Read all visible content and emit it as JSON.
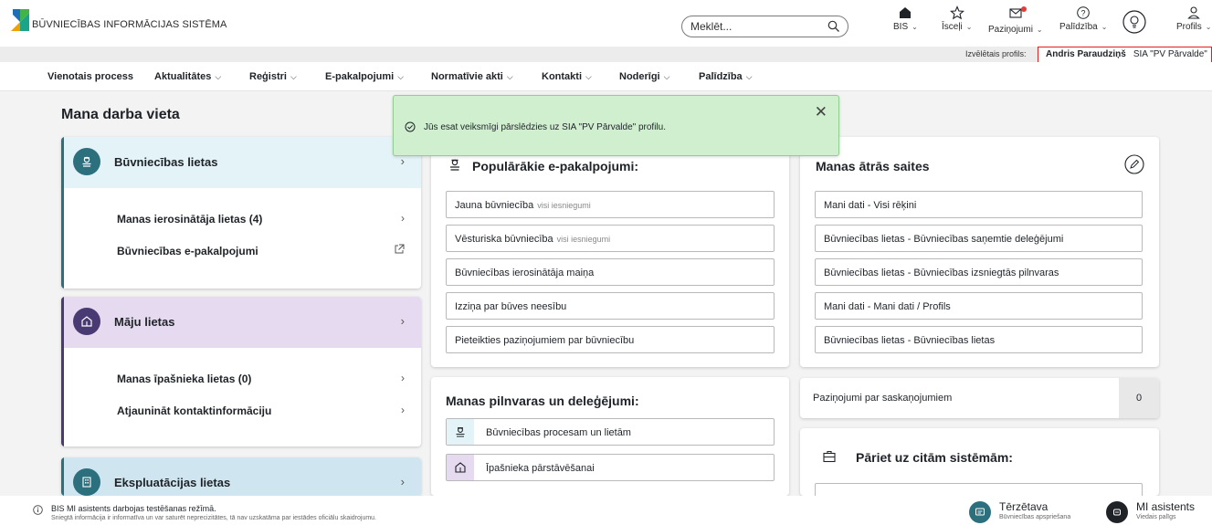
{
  "header": {
    "logo_text": "BŪVNIECĪBAS INFORMĀCIJAS SISTĒMA",
    "search_placeholder": "Meklēt...",
    "nav": {
      "bis": "BIS",
      "isceli": "Īsceļi",
      "pazinojumi": "Paziņojumi",
      "palidziba": "Palīdzība",
      "profils": "Profils"
    }
  },
  "profile_bar": {
    "label": "Izvēlētais profils:",
    "user": "Andris Paraudziņš",
    "org": "SIA \"PV Pārvalde\""
  },
  "menu": {
    "items": [
      "Vienotais process",
      "Aktualitātes",
      "Reģistri",
      "E-pakalpojumi",
      "Normatīvie akti",
      "Kontakti",
      "Noderīgi",
      "Palīdzība"
    ]
  },
  "page": {
    "title": "Mana darba vieta"
  },
  "toast": {
    "message": "Jūs esat veiksmīgi pārslēdzies uz SIA \"PV Pārvalde\" profilu."
  },
  "cards": {
    "buvniecibas": {
      "title": "Būvniecības lietas",
      "links": [
        "Manas ierosinātāja lietas (4)",
        "Būvniecības e-pakalpojumi"
      ]
    },
    "maju": {
      "title": "Māju lietas",
      "links": [
        "Manas īpašnieka lietas (0)",
        "Atjaunināt kontaktinformāciju"
      ]
    },
    "ekspluatacijas": {
      "title": "Ekspluatācijas lietas"
    }
  },
  "popular": {
    "title": "Populārākie e-pakalpojumi:",
    "items": [
      {
        "label": "Jauna būvniecība",
        "sub": "visi iesniegumi"
      },
      {
        "label": "Vēsturiska būvniecība",
        "sub": "visi iesniegumi"
      },
      {
        "label": "Būvniecības ierosinātāja maiņa",
        "sub": ""
      },
      {
        "label": "Izziņa par būves neesību",
        "sub": ""
      },
      {
        "label": "Pieteikties paziņojumiem par būvniecību",
        "sub": ""
      }
    ]
  },
  "quicklinks": {
    "title": "Manas ātrās saites",
    "items": [
      "Mani dati - Visi rēķini",
      "Būvniecības lietas - Būvniecības saņemtie deleģējumi",
      "Būvniecības lietas - Būvniecības izsniegtās pilnvaras",
      "Mani dati - Mani dati / Profils",
      "Būvniecības lietas - Būvniecības lietas"
    ]
  },
  "delegations": {
    "title": "Manas pilnvaras un deleģējumi:",
    "items": [
      "Būvniecības procesam un lietām",
      "Īpašnieka pārstāvēšanai"
    ]
  },
  "notifications": {
    "label": "Paziņojumi par saskaņojumiem",
    "count": "0"
  },
  "other_systems": {
    "title": "Pāriet uz citām sistēmām:"
  },
  "footer": {
    "line1": "BIS MI asistents darbojas testēšanas režīmā.",
    "line2": "Sniegtā informācija ir informatīva un var saturēt neprecizitātes, tā nav uzskatāma par iestādes oficiālu skaidrojumu.",
    "chat_title": "Tērzētava",
    "chat_sub": "Būvniecības apspriešana",
    "ai_title": "MI asistents",
    "ai_sub": "Viedais palīgs"
  },
  "colors": {
    "buvniecibas_bg": "#e3f3f7",
    "buvniecibas_accent": "#2c6f7d",
    "maju_bg": "#e6daf0",
    "maju_accent": "#4a3a73",
    "ekspl_bg": "#cfe6f0",
    "ekspl_accent": "#2c6f7d",
    "toast_bg": "#cfefcf"
  }
}
